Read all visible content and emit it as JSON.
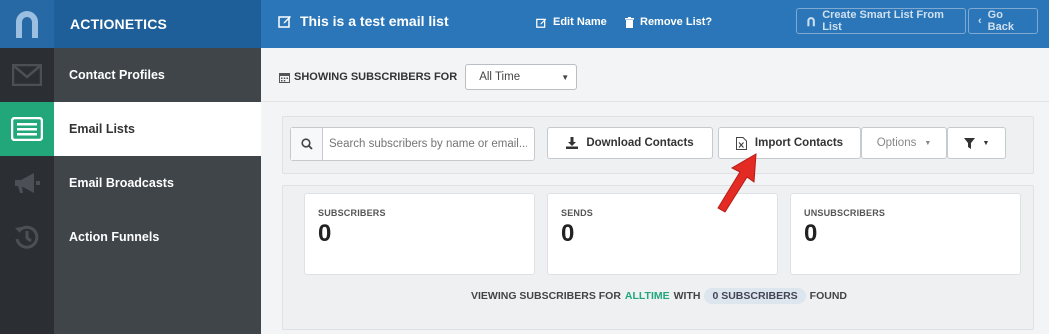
{
  "header": {
    "brand": "ACTIONETICS",
    "list_title": "This is a test email list",
    "edit_name": "Edit Name",
    "remove_list": "Remove List?",
    "create_smart_list": "Create Smart List From List",
    "go_back": "Go Back"
  },
  "sidebar": {
    "items": [
      {
        "label": "Contact Profiles",
        "icon": "envelope-icon"
      },
      {
        "label": "Email Lists",
        "icon": "list-icon"
      },
      {
        "label": "Email Broadcasts",
        "icon": "megaphone-icon"
      },
      {
        "label": "Action Funnels",
        "icon": "history-icon"
      }
    ],
    "active_index": 1
  },
  "filter": {
    "label": "SHOWING SUBSCRIBERS FOR",
    "selected": "All Time"
  },
  "toolbar": {
    "search_placeholder": "Search subscribers by name or email...",
    "download": "Download Contacts",
    "import": "Import Contacts",
    "options": "Options"
  },
  "stats": {
    "subscribers_label": "SUBSCRIBERS",
    "subscribers_value": "0",
    "sends_label": "SENDS",
    "sends_value": "0",
    "unsubscribers_label": "UNSUBSCRIBERS",
    "unsubscribers_value": "0"
  },
  "footer": {
    "prefix": "VIEWING SUBSCRIBERS FOR",
    "period": "ALLTIME",
    "with": "WITH",
    "count_pill": "0 SUBSCRIBERS",
    "suffix": "FOUND"
  },
  "colors": {
    "header_blue": "#2a76b8",
    "active_green": "#22a77a",
    "sidebar_dark": "#3f4549",
    "arrow_red": "#e32b23"
  }
}
